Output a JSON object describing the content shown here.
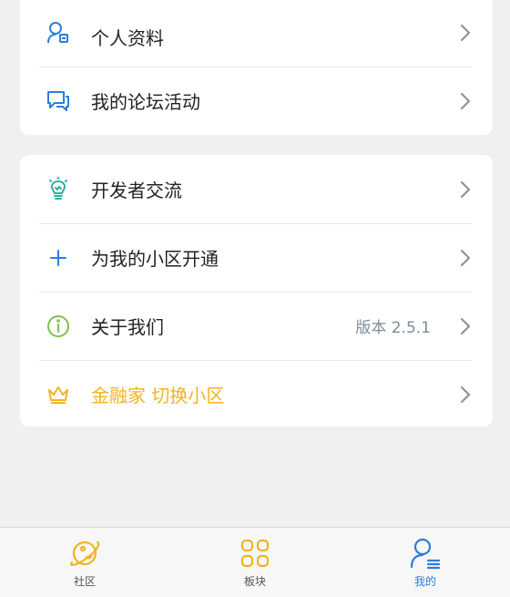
{
  "menu_group_1": [
    {
      "label": "个人资料",
      "icon": "user-card-icon"
    },
    {
      "label": "我的论坛活动",
      "icon": "chat-bubbles-icon"
    }
  ],
  "menu_group_2": [
    {
      "label": "开发者交流",
      "icon": "lightbulb-icon"
    },
    {
      "label": "为我的小区开通",
      "icon": "plus-icon"
    },
    {
      "label": "关于我们",
      "icon": "info-icon",
      "value": "版本 2.5.1"
    },
    {
      "label": "金融家 切换小区",
      "icon": "crown-icon"
    }
  ],
  "tabs": [
    {
      "label": "社区",
      "icon": "planet-icon",
      "active": false
    },
    {
      "label": "板块",
      "icon": "grid-icon",
      "active": false
    },
    {
      "label": "我的",
      "icon": "profile-icon",
      "active": true
    }
  ],
  "colors": {
    "blue": "#2a7fd8",
    "teal": "#29b3a0",
    "green": "#7cc24a",
    "gold": "#f0b422",
    "chevron": "#8a949c"
  }
}
